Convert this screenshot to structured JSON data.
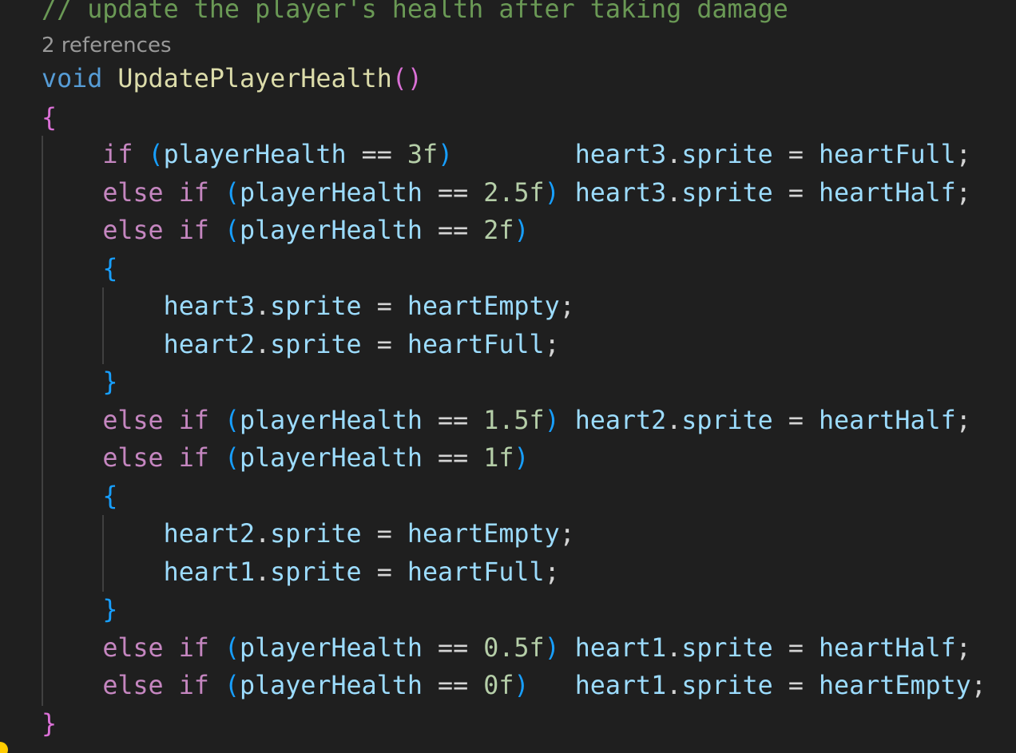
{
  "editor": {
    "colors": {
      "background": "#1f1f1f",
      "comment": "#6a9955",
      "keyword": "#569cd6",
      "control": "#c586c0",
      "function": "#dcdcaa",
      "variable": "#9cdcfe",
      "number": "#b5cea8",
      "punctuation": "#d4d4d4",
      "bracket_level1": "#ffd700",
      "bracket_level2": "#da70d6",
      "bracket_level3": "#179fff",
      "codelens": "#999999"
    },
    "codelens": "2 references",
    "lines": [
      [
        [
          "// update the player's health after taking damage",
          "comment"
        ]
      ],
      [
        [
          "void",
          "keyword"
        ],
        [
          " ",
          "punctuation"
        ],
        [
          "UpdatePlayerHealth",
          "function"
        ],
        [
          "()",
          "bracket_level2"
        ]
      ],
      [
        [
          "{",
          "bracket_level2"
        ]
      ],
      [
        [
          "    ",
          "punctuation"
        ],
        [
          "if",
          "control"
        ],
        [
          " ",
          "punctuation"
        ],
        [
          "(",
          "bracket_level3"
        ],
        [
          "playerHealth",
          "variable"
        ],
        [
          " == ",
          "punctuation"
        ],
        [
          "3f",
          "number"
        ],
        [
          ")",
          "bracket_level3"
        ],
        [
          "        ",
          "punctuation"
        ],
        [
          "heart3",
          "variable"
        ],
        [
          ".",
          "punctuation"
        ],
        [
          "sprite",
          "variable"
        ],
        [
          " = ",
          "punctuation"
        ],
        [
          "heartFull",
          "variable"
        ],
        [
          ";",
          "punctuation"
        ]
      ],
      [
        [
          "    ",
          "punctuation"
        ],
        [
          "else",
          "control"
        ],
        [
          " ",
          "punctuation"
        ],
        [
          "if",
          "control"
        ],
        [
          " ",
          "punctuation"
        ],
        [
          "(",
          "bracket_level3"
        ],
        [
          "playerHealth",
          "variable"
        ],
        [
          " == ",
          "punctuation"
        ],
        [
          "2.5f",
          "number"
        ],
        [
          ")",
          "bracket_level3"
        ],
        [
          " ",
          "punctuation"
        ],
        [
          "heart3",
          "variable"
        ],
        [
          ".",
          "punctuation"
        ],
        [
          "sprite",
          "variable"
        ],
        [
          " = ",
          "punctuation"
        ],
        [
          "heartHalf",
          "variable"
        ],
        [
          ";",
          "punctuation"
        ]
      ],
      [
        [
          "    ",
          "punctuation"
        ],
        [
          "else",
          "control"
        ],
        [
          " ",
          "punctuation"
        ],
        [
          "if",
          "control"
        ],
        [
          " ",
          "punctuation"
        ],
        [
          "(",
          "bracket_level3"
        ],
        [
          "playerHealth",
          "variable"
        ],
        [
          " == ",
          "punctuation"
        ],
        [
          "2f",
          "number"
        ],
        [
          ")",
          "bracket_level3"
        ]
      ],
      [
        [
          "    ",
          "punctuation"
        ],
        [
          "{",
          "bracket_level3"
        ]
      ],
      [
        [
          "        ",
          "punctuation"
        ],
        [
          "heart3",
          "variable"
        ],
        [
          ".",
          "punctuation"
        ],
        [
          "sprite",
          "variable"
        ],
        [
          " = ",
          "punctuation"
        ],
        [
          "heartEmpty",
          "variable"
        ],
        [
          ";",
          "punctuation"
        ]
      ],
      [
        [
          "        ",
          "punctuation"
        ],
        [
          "heart2",
          "variable"
        ],
        [
          ".",
          "punctuation"
        ],
        [
          "sprite",
          "variable"
        ],
        [
          " = ",
          "punctuation"
        ],
        [
          "heartFull",
          "variable"
        ],
        [
          ";",
          "punctuation"
        ]
      ],
      [
        [
          "    ",
          "punctuation"
        ],
        [
          "}",
          "bracket_level3"
        ]
      ],
      [
        [
          "    ",
          "punctuation"
        ],
        [
          "else",
          "control"
        ],
        [
          " ",
          "punctuation"
        ],
        [
          "if",
          "control"
        ],
        [
          " ",
          "punctuation"
        ],
        [
          "(",
          "bracket_level3"
        ],
        [
          "playerHealth",
          "variable"
        ],
        [
          " == ",
          "punctuation"
        ],
        [
          "1.5f",
          "number"
        ],
        [
          ")",
          "bracket_level3"
        ],
        [
          " ",
          "punctuation"
        ],
        [
          "heart2",
          "variable"
        ],
        [
          ".",
          "punctuation"
        ],
        [
          "sprite",
          "variable"
        ],
        [
          " = ",
          "punctuation"
        ],
        [
          "heartHalf",
          "variable"
        ],
        [
          ";",
          "punctuation"
        ]
      ],
      [
        [
          "    ",
          "punctuation"
        ],
        [
          "else",
          "control"
        ],
        [
          " ",
          "punctuation"
        ],
        [
          "if",
          "control"
        ],
        [
          " ",
          "punctuation"
        ],
        [
          "(",
          "bracket_level3"
        ],
        [
          "playerHealth",
          "variable"
        ],
        [
          " == ",
          "punctuation"
        ],
        [
          "1f",
          "number"
        ],
        [
          ")",
          "bracket_level3"
        ]
      ],
      [
        [
          "    ",
          "punctuation"
        ],
        [
          "{",
          "bracket_level3"
        ]
      ],
      [
        [
          "        ",
          "punctuation"
        ],
        [
          "heart2",
          "variable"
        ],
        [
          ".",
          "punctuation"
        ],
        [
          "sprite",
          "variable"
        ],
        [
          " = ",
          "punctuation"
        ],
        [
          "heartEmpty",
          "variable"
        ],
        [
          ";",
          "punctuation"
        ]
      ],
      [
        [
          "        ",
          "punctuation"
        ],
        [
          "heart1",
          "variable"
        ],
        [
          ".",
          "punctuation"
        ],
        [
          "sprite",
          "variable"
        ],
        [
          " = ",
          "punctuation"
        ],
        [
          "heartFull",
          "variable"
        ],
        [
          ";",
          "punctuation"
        ]
      ],
      [
        [
          "    ",
          "punctuation"
        ],
        [
          "}",
          "bracket_level3"
        ]
      ],
      [
        [
          "    ",
          "punctuation"
        ],
        [
          "else",
          "control"
        ],
        [
          " ",
          "punctuation"
        ],
        [
          "if",
          "control"
        ],
        [
          " ",
          "punctuation"
        ],
        [
          "(",
          "bracket_level3"
        ],
        [
          "playerHealth",
          "variable"
        ],
        [
          " == ",
          "punctuation"
        ],
        [
          "0.5f",
          "number"
        ],
        [
          ")",
          "bracket_level3"
        ],
        [
          " ",
          "punctuation"
        ],
        [
          "heart1",
          "variable"
        ],
        [
          ".",
          "punctuation"
        ],
        [
          "sprite",
          "variable"
        ],
        [
          " = ",
          "punctuation"
        ],
        [
          "heartHalf",
          "variable"
        ],
        [
          ";",
          "punctuation"
        ]
      ],
      [
        [
          "    ",
          "punctuation"
        ],
        [
          "else",
          "control"
        ],
        [
          " ",
          "punctuation"
        ],
        [
          "if",
          "control"
        ],
        [
          " ",
          "punctuation"
        ],
        [
          "(",
          "bracket_level3"
        ],
        [
          "playerHealth",
          "variable"
        ],
        [
          " == ",
          "punctuation"
        ],
        [
          "0f",
          "number"
        ],
        [
          ")",
          "bracket_level3"
        ],
        [
          "   ",
          "punctuation"
        ],
        [
          "heart1",
          "variable"
        ],
        [
          ".",
          "punctuation"
        ],
        [
          "sprite",
          "variable"
        ],
        [
          " = ",
          "punctuation"
        ],
        [
          "heartEmpty",
          "variable"
        ],
        [
          ";",
          "punctuation"
        ]
      ],
      [
        [
          "}",
          "bracket_level2"
        ]
      ]
    ]
  }
}
